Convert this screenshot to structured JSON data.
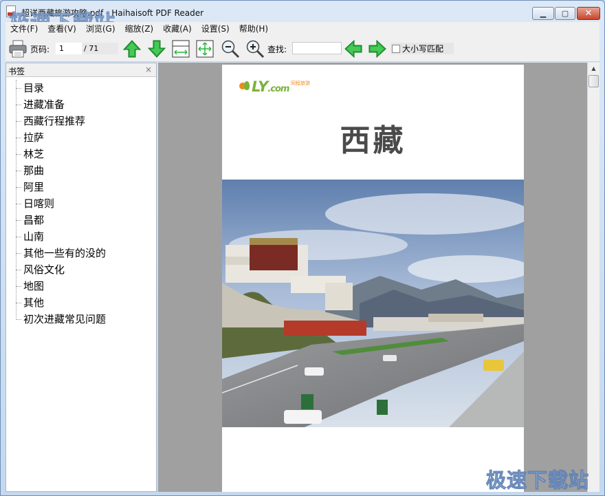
{
  "window": {
    "title": "超详西藏旅游攻略.pdf - Haihaisoft PDF Reader",
    "minimize_label": "▁",
    "maximize_label": "▢",
    "close_label": "✕"
  },
  "watermark": {
    "text": "极速下载站"
  },
  "menu": [
    {
      "id": "file",
      "label": "文件(F)"
    },
    {
      "id": "view",
      "label": "查看(V)"
    },
    {
      "id": "browse",
      "label": "浏览(G)"
    },
    {
      "id": "zoom",
      "label": "缩放(Z)"
    },
    {
      "id": "favorites",
      "label": "收藏(A)"
    },
    {
      "id": "settings",
      "label": "设置(S)"
    },
    {
      "id": "help",
      "label": "帮助(H)"
    }
  ],
  "toolbar": {
    "page_label": "页码:",
    "page_value": "1",
    "page_total": "/ 71",
    "search_label": "查找:",
    "search_value": "",
    "match_case_label": "大小写匹配",
    "icons": {
      "print": "printer-icon",
      "prev": "arrow-up-icon",
      "next": "arrow-down-icon",
      "fit_width": "fit-width-icon",
      "fit_page": "fit-page-icon",
      "zoom_out": "zoom-out-icon",
      "zoom_in": "zoom-in-icon",
      "find_prev": "arrow-left-icon",
      "find_next": "arrow-right-icon"
    },
    "accent_green": "#27b43a"
  },
  "bookmarks": {
    "title": "书签",
    "close_label": "×",
    "items": [
      "目录",
      "进藏准备",
      "西藏行程推荐",
      "拉萨",
      "林芝",
      "那曲",
      "阿里",
      "日喀则",
      "昌都",
      "山南",
      "其他一些有的没的",
      "风俗文化",
      "地图",
      "其他",
      "初次进藏常见问题"
    ]
  },
  "document": {
    "logo_text": "LY",
    "logo_suffix": ".com",
    "logo_sub": "同程旅游",
    "heading": "西藏",
    "photo": "potala-palace-photo"
  }
}
